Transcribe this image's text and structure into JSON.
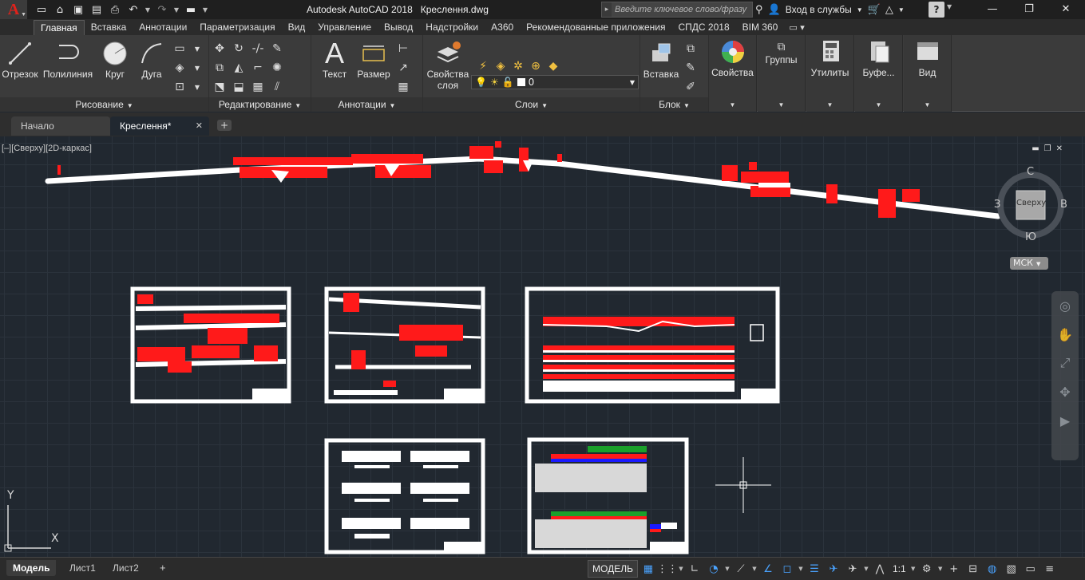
{
  "app": {
    "logo_letter": "A",
    "title": "Autodesk AutoCAD 2018",
    "document": "Креслення.dwg"
  },
  "search": {
    "placeholder": "Введите ключевое слово/фразу"
  },
  "account": {
    "signin_label": "Вход в службы"
  },
  "help_label": "?",
  "ribbon_tabs": [
    "Главная",
    "Вставка",
    "Аннотации",
    "Параметризация",
    "Вид",
    "Управление",
    "Вывод",
    "Надстройки",
    "A360",
    "Рекомендованные приложения",
    "СПДС 2018",
    "BIM 360"
  ],
  "panels": {
    "draw": {
      "title": "Рисование",
      "buttons": [
        "Отрезок",
        "Полилиния",
        "Круг",
        "Дуга"
      ]
    },
    "modify": {
      "title": "Редактирование"
    },
    "annotation": {
      "title": "Аннотации",
      "buttons": [
        "Текст",
        "Размер"
      ]
    },
    "layers": {
      "title": "Слои",
      "properties_label": "Свойства слоя",
      "current_layer": "0"
    },
    "block": {
      "title": "Блок",
      "insert_label": "Вставка"
    },
    "properties": {
      "label": "Свойства"
    },
    "groups": {
      "label": "Группы"
    },
    "utilities": {
      "label": "Утилиты"
    },
    "clipboard": {
      "label": "Буфе..."
    },
    "view": {
      "label": "Вид"
    }
  },
  "file_tabs": {
    "start": "Начало",
    "drawing": "Креслення*"
  },
  "viewport": {
    "label": "[–][Сверху][2D-каркас]"
  },
  "viewcube": {
    "top": "С",
    "bottom": "Ю",
    "left": "З",
    "right": "В",
    "face": "Сверху"
  },
  "ucs_label": "МСК",
  "ucs_axes": {
    "x": "X",
    "y": "Y"
  },
  "layout_tabs": [
    "Модель",
    "Лист1",
    "Лист2"
  ],
  "status": {
    "model_label": "МОДЕЛЬ",
    "scale": "1:1"
  },
  "colors": {
    "background": "#212830",
    "accent_red": "#e0221b",
    "drawing_red": "#ff1a1a"
  }
}
